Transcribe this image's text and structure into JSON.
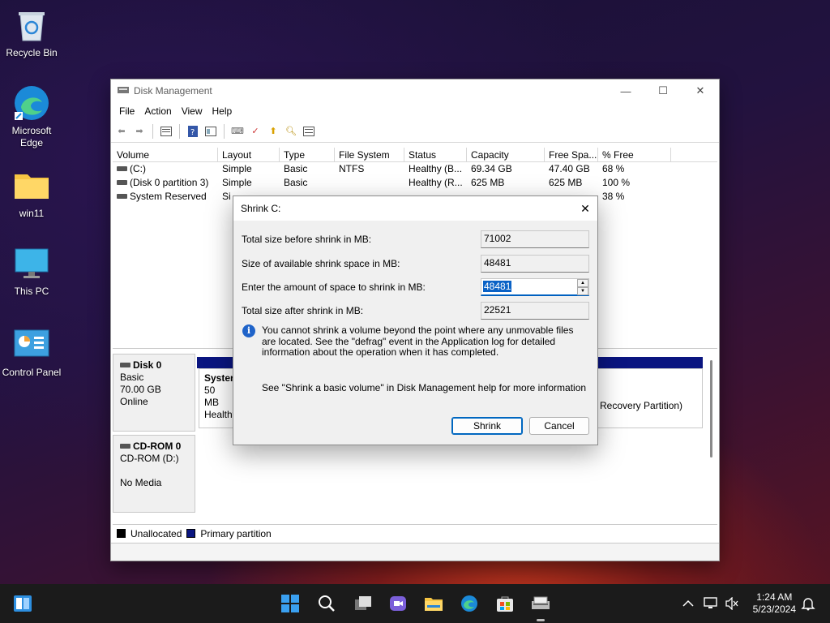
{
  "desktop": {
    "icons": [
      {
        "label": "Recycle Bin"
      },
      {
        "label": "Microsoft\nEdge"
      },
      {
        "label": "win11"
      },
      {
        "label": "This PC"
      },
      {
        "label": "Control Panel"
      }
    ]
  },
  "window": {
    "title": "Disk Management",
    "menu": [
      "File",
      "Action",
      "View",
      "Help"
    ],
    "columns": [
      "Volume",
      "Layout",
      "Type",
      "File System",
      "Status",
      "Capacity",
      "Free Spa...",
      "% Free"
    ],
    "volumes": [
      {
        "volume": "(C:)",
        "layout": "Simple",
        "type": "Basic",
        "fs": "NTFS",
        "status": "Healthy (B...",
        "capacity": "69.34 GB",
        "free": "47.40 GB",
        "pct": "68 %"
      },
      {
        "volume": "(Disk 0 partition 3)",
        "layout": "Simple",
        "type": "Basic",
        "fs": "",
        "status": "Healthy (R...",
        "capacity": "625 MB",
        "free": "625 MB",
        "pct": "100 %"
      },
      {
        "volume": "System Reserved",
        "layout": "Si",
        "type": "",
        "fs": "",
        "status": "",
        "capacity": "",
        "free": "",
        "pct": "38 %"
      }
    ],
    "disk0": {
      "name": "Disk 0",
      "type": "Basic",
      "size": "70.00 GB",
      "state": "Online"
    },
    "disk0_part1": {
      "name": "Syster",
      "size": "50 MB",
      "status": "Healthy"
    },
    "disk0_part3": {
      "status": "Recovery Partition)"
    },
    "cdrom": {
      "name": "CD-ROM 0",
      "type": "CD-ROM (D:)",
      "state": "No Media"
    },
    "legend": {
      "unallocated": "Unallocated",
      "primary": "Primary partition"
    }
  },
  "dialog": {
    "title": "Shrink C:",
    "total_before_label": "Total size before shrink in MB:",
    "total_before_value": "71002",
    "available_label": "Size of available shrink space in MB:",
    "available_value": "48481",
    "enter_label": "Enter the amount of space to shrink in MB:",
    "enter_value": "48481",
    "total_after_label": "Total size after shrink in MB:",
    "total_after_value": "22521",
    "info_text": "You cannot shrink a volume beyond the point where any unmovable files are located. See the \"defrag\" event in the Application log for detailed information about the operation when it has completed.",
    "help_text": "See \"Shrink a basic volume\" in Disk Management help for more information",
    "shrink_label": "Shrink",
    "cancel_label": "Cancel"
  },
  "taskbar": {
    "time": "1:24 AM",
    "date": "5/23/2024"
  },
  "colors": {
    "primary_partition": "#0a1580",
    "accent": "#0067c0"
  }
}
